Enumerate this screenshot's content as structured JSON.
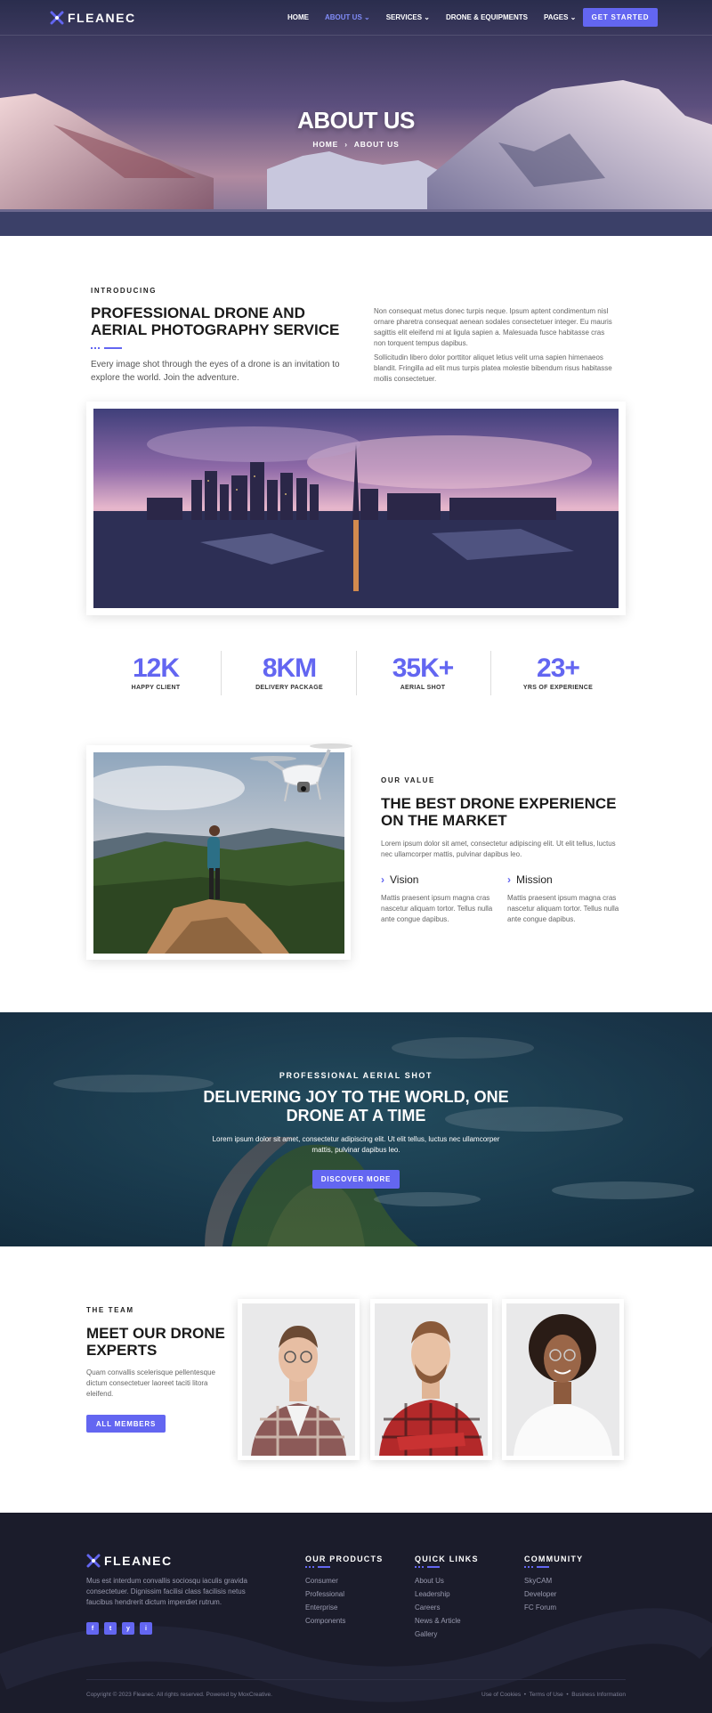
{
  "brand": {
    "name": "FLEANEC"
  },
  "nav": {
    "items": [
      {
        "label": "HOME",
        "active": false,
        "dropdown": false
      },
      {
        "label": "ABOUT US",
        "active": true,
        "dropdown": true
      },
      {
        "label": "SERVICES",
        "active": false,
        "dropdown": true
      },
      {
        "label": "DRONE & EQUIPMENTS",
        "active": false,
        "dropdown": false
      },
      {
        "label": "PAGES",
        "active": false,
        "dropdown": true
      }
    ],
    "cta": "GET STARTED"
  },
  "hero": {
    "title": "ABOUT US",
    "crumb_home": "HOME",
    "crumb_current": "ABOUT US"
  },
  "intro": {
    "eyebrow": "INTRODUCING",
    "title": "PROFESSIONAL DRONE AND AERIAL PHOTOGRAPHY SERVICE",
    "lead": "Every image shot through the eyes of a drone is an invitation to explore the world. Join the adventure.",
    "para1": "Non consequat metus donec turpis neque. Ipsum aptent condimentum nisl ornare pharetra consequat aenean sodales consectetuer integer. Eu mauris sagittis elit eleifend mi at ligula sapien a. Malesuada fusce habitasse cras non torquent tempus dapibus.",
    "para2": "Sollicitudin libero dolor porttitor aliquet letius velit urna sapien himenaeos blandit. Fringilla ad elit mus turpis platea molestie bibendum risus habitasse mollis consectetuer."
  },
  "stats": [
    {
      "value": "12K",
      "label": "HAPPY CLIENT"
    },
    {
      "value": "8KM",
      "label": "DELIVERY PACKAGE"
    },
    {
      "value": "35K+",
      "label": "AERIAL SHOT"
    },
    {
      "value": "23+",
      "label": "YRS OF EXPERIENCE"
    }
  ],
  "value": {
    "eyebrow": "OUR VALUE",
    "title": "THE BEST DRONE EXPERIENCE ON THE MARKET",
    "text": "Lorem ipsum dolor sit amet, consectetur adipiscing elit. Ut elit tellus, luctus nec ullamcorper mattis, pulvinar dapibus leo.",
    "vision_title": "Vision",
    "vision_text": "Mattis praesent ipsum magna cras nascetur aliquam tortor. Tellus nulla ante congue dapibus.",
    "mission_title": "Mission",
    "mission_text": "Mattis praesent ipsum magna cras nascetur aliquam tortor. Tellus nulla ante congue dapibus."
  },
  "banner": {
    "eyebrow": "PROFESSIONAL AERIAL SHOT",
    "title": "DELIVERING JOY TO THE WORLD, ONE DRONE AT A TIME",
    "text": "Lorem ipsum dolor sit amet, consectetur adipiscing elit. Ut elit tellus, luctus nec ullamcorper mattis, pulvinar dapibus leo.",
    "button": "DISCOVER MORE"
  },
  "team": {
    "eyebrow": "THE TEAM",
    "title": "MEET OUR DRONE EXPERTS",
    "text": "Quam convallis scelerisque pellentesque dictum consectetuer laoreet taciti litora eleifend.",
    "button": "ALL MEMBERS"
  },
  "footer": {
    "about": "Mus est interdum convallis sociosqu iaculis gravida consectetuer. Dignissim facilisi class facilisis netus faucibus hendrerit dictum imperdiet rutrum.",
    "social": [
      "f",
      "t",
      "y",
      "i"
    ],
    "products_title": "OUR PRODUCTS",
    "products": [
      "Consumer",
      "Professional",
      "Enterprise",
      "Components"
    ],
    "links_title": "QUICK LINKS",
    "links": [
      "About Us",
      "Leadership",
      "Careers",
      "News & Article",
      "Gallery"
    ],
    "community_title": "COMMUNITY",
    "community": [
      "SkyCAM",
      "Developer",
      "FC Forum"
    ],
    "copyright": "Copyright © 2023 Fleanec. All rights reserved. Powered by MoxCreative.",
    "legal": [
      "Use of Cookies",
      "Terms of Use",
      "Business Information"
    ]
  },
  "colors": {
    "accent": "#6366f1",
    "dark": "#1b1c2b"
  }
}
